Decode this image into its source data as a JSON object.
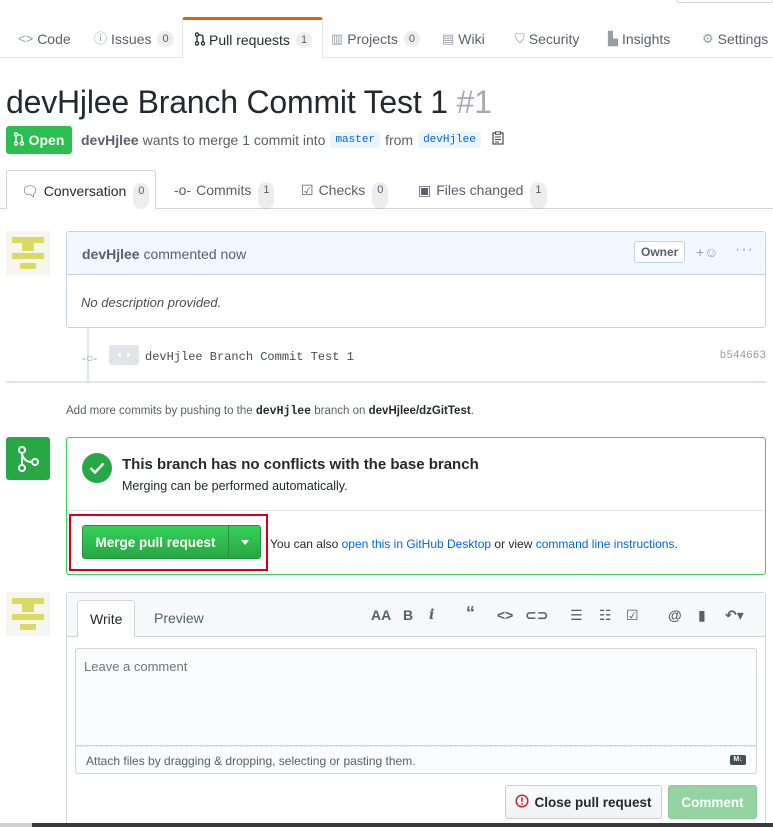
{
  "repo_nav": {
    "tabs": [
      {
        "label": "Code",
        "icon": "code-icon"
      },
      {
        "label": "Issues",
        "icon": "issue-icon",
        "count": "0"
      },
      {
        "label": "Pull requests",
        "icon": "pull-request-icon",
        "count": "1",
        "selected": true
      },
      {
        "label": "Projects",
        "icon": "project-icon",
        "count": "0"
      },
      {
        "label": "Wiki",
        "icon": "book-icon"
      },
      {
        "label": "Security",
        "icon": "shield-icon"
      },
      {
        "label": "Insights",
        "icon": "graph-icon"
      },
      {
        "label": "Settings",
        "icon": "gear-icon"
      }
    ]
  },
  "pr": {
    "title": "devHjlee Branch Commit Test 1",
    "number": "#1",
    "state": "Open",
    "author": "devHjlee",
    "meta_text": "wants to merge 1 commit into",
    "base_branch": "master",
    "from_text": "from",
    "head_branch": "devHjlee"
  },
  "pr_tabs": [
    {
      "label": "Conversation",
      "count": "0",
      "selected": true
    },
    {
      "label": "Commits",
      "count": "1"
    },
    {
      "label": "Checks",
      "count": "0"
    },
    {
      "label": "Files changed",
      "count": "1"
    }
  ],
  "comment": {
    "author": "devHjlee",
    "action": "commented now",
    "role_badge": "Owner",
    "body": "No description provided."
  },
  "commit": {
    "message": "devHjlee Branch Commit Test 1",
    "sha": "b544663"
  },
  "push_note": {
    "prefix": "Add more commits by pushing to the",
    "branch": "devHjlee",
    "middle": "branch on",
    "repo": "devHjlee/dzGitTest",
    "suffix": "."
  },
  "merge": {
    "title": "This branch has no conflicts with the base branch",
    "subtitle": "Merging can be performed automatically.",
    "button_label": "Merge pull request",
    "also_prefix": "You can also",
    "desktop_link": "open this in GitHub Desktop",
    "or_view": "or view",
    "cli_link": "command line instructions",
    "suffix": "."
  },
  "new_comment": {
    "write_tab": "Write",
    "preview_tab": "Preview",
    "placeholder": "Leave a comment",
    "attach_text": "Attach files by dragging & dropping, selecting or pasting them.",
    "md_badge": "M↓",
    "close_button": "Close pull request",
    "comment_button": "Comment"
  },
  "colors": {
    "accent_orange": "#e36209",
    "success_green": "#28a745",
    "link_blue": "#0366d6",
    "highlight_red": "#d0021b"
  }
}
